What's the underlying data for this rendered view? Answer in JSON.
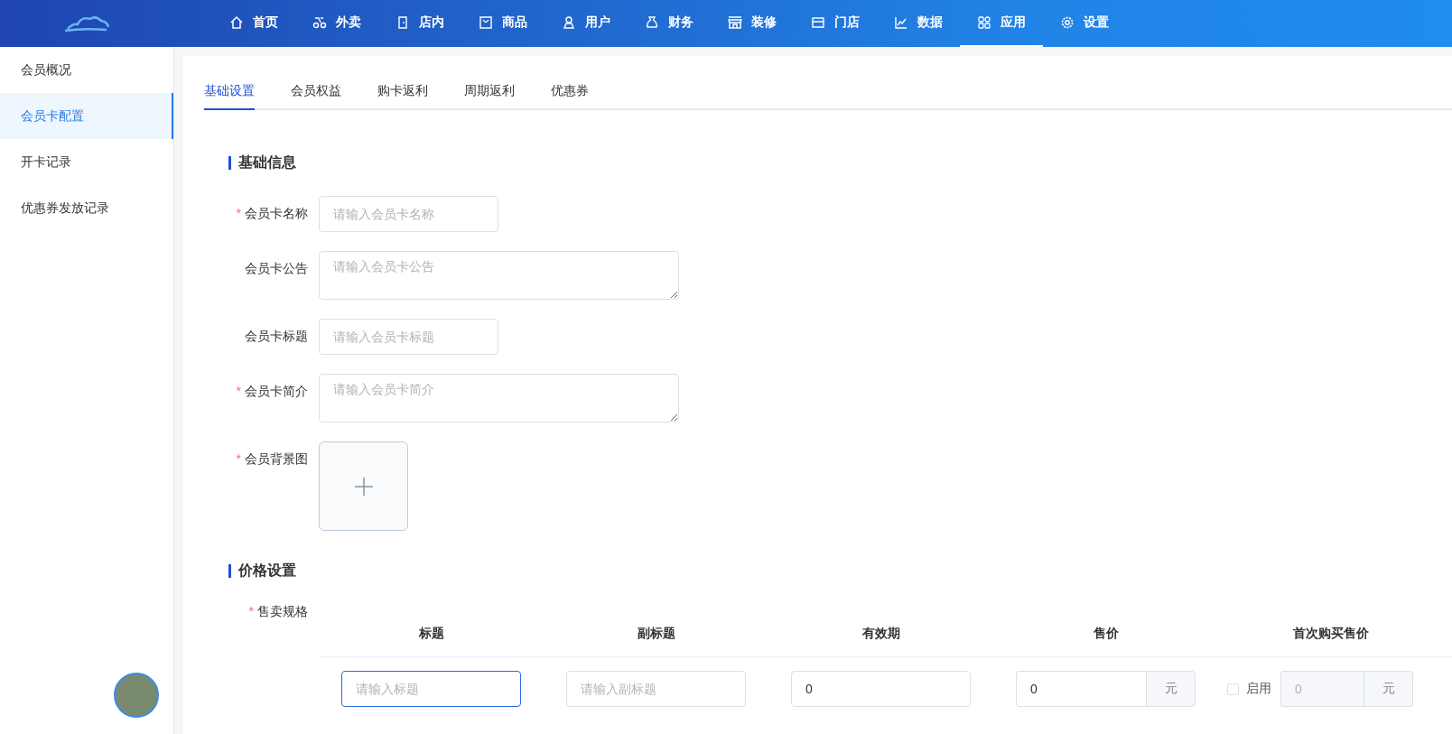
{
  "nav": {
    "items": [
      {
        "label": "首页",
        "selected": false
      },
      {
        "label": "外卖",
        "selected": false
      },
      {
        "label": "店内",
        "selected": false
      },
      {
        "label": "商品",
        "selected": false
      },
      {
        "label": "用户",
        "selected": false
      },
      {
        "label": "财务",
        "selected": false
      },
      {
        "label": "装修",
        "selected": false
      },
      {
        "label": "门店",
        "selected": false
      },
      {
        "label": "数据",
        "selected": false
      },
      {
        "label": "应用",
        "selected": true
      },
      {
        "label": "设置",
        "selected": false
      }
    ]
  },
  "required_symbol": "*",
  "sidebar": {
    "items": [
      {
        "label": "会员概况",
        "selected": false
      },
      {
        "label": "会员卡配置",
        "selected": true
      },
      {
        "label": "开卡记录",
        "selected": false
      },
      {
        "label": "优惠券发放记录",
        "selected": false
      }
    ]
  },
  "tabs": [
    {
      "label": "基础设置",
      "selected": true
    },
    {
      "label": "会员权益",
      "selected": false
    },
    {
      "label": "购卡返利",
      "selected": false
    },
    {
      "label": "周期返利",
      "selected": false
    },
    {
      "label": "优惠券",
      "selected": false
    }
  ],
  "basic": {
    "title": "基础信息",
    "fields": [
      {
        "kind": "input",
        "label": "会员卡名称",
        "required": true,
        "placeholder": "请输入会员卡名称"
      },
      {
        "kind": "textarea",
        "label": "会员卡公告",
        "required": false,
        "placeholder": "请输入会员卡公告"
      },
      {
        "kind": "input",
        "label": "会员卡标题",
        "required": false,
        "placeholder": "请输入会员卡标题"
      },
      {
        "kind": "textarea",
        "label": "会员卡简介",
        "required": true,
        "placeholder": "请输入会员卡简介"
      },
      {
        "kind": "upload",
        "label": "会员背景图",
        "required": true
      }
    ]
  },
  "price": {
    "title": "价格设置",
    "label": "售卖规格",
    "required": true,
    "columns": [
      "标题",
      "副标题",
      "有效期",
      "售价",
      "首次购买售价"
    ],
    "row": {
      "title": {
        "placeholder": "请输入标题",
        "focused": true
      },
      "subtitle": {
        "placeholder": "请输入副标题"
      },
      "validity": "0",
      "price": "0",
      "price_unit": "元",
      "first": {
        "checkbox_label": "启用",
        "checked": false,
        "value": "0",
        "unit": "元",
        "disabled": true
      }
    }
  }
}
